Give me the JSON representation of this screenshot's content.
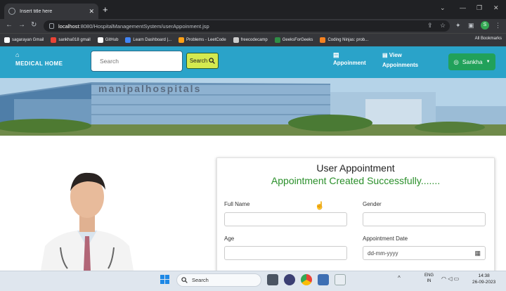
{
  "browser": {
    "tab_title": "Insert title here",
    "new_tab": "+",
    "url_host": "localhost",
    "url_rest": ":8080/HospitalManagementSystem/userAppoinment.jsp",
    "profile_initial": "S",
    "bookmarks": [
      {
        "label": "sagarayan Gmail",
        "color": "#ffffff"
      },
      {
        "label": "sankha018 gmail",
        "color": "#ea4335"
      },
      {
        "label": "GitHub",
        "color": "#ffffff"
      },
      {
        "label": "Learn Dashboard |...",
        "color": "#4285f4"
      },
      {
        "label": "Problems - LeetCode",
        "color": "#ffa116"
      },
      {
        "label": "freecodecamp",
        "color": "#cccccc"
      },
      {
        "label": "GeeksForGeeks",
        "color": "#2f8d46"
      },
      {
        "label": "Coding Ninjas: prob...",
        "color": "#f58220"
      }
    ],
    "all_bookmarks": "All Bookmarks"
  },
  "header": {
    "home_label": "MEDICAL HOME",
    "search_placeholder": "Search",
    "search_button": "Search",
    "nav_appointment": "Appoinment",
    "nav_view": "View",
    "nav_view2": "Appoinments",
    "user_name": "Sankha"
  },
  "banner": {
    "building_sign": "manipalhospitals"
  },
  "form": {
    "title": "User Appointment",
    "success_message": "Appointment Created Successfully.......",
    "fullname_label": "Full Name",
    "gender_label": "Gender",
    "age_label": "Age",
    "date_label": "Appointment Date",
    "date_placeholder": "dd-mm-yyyy"
  },
  "taskbar": {
    "search_label": "Search",
    "lang_top": "ENG",
    "lang_bottom": "IN",
    "time": "14:38",
    "date": "26-09-2023"
  },
  "colors": {
    "header_bg": "#2aa3c9",
    "search_btn": "#d4e94f",
    "user_btn": "#21a15a",
    "success_text": "#2a8f2a"
  }
}
